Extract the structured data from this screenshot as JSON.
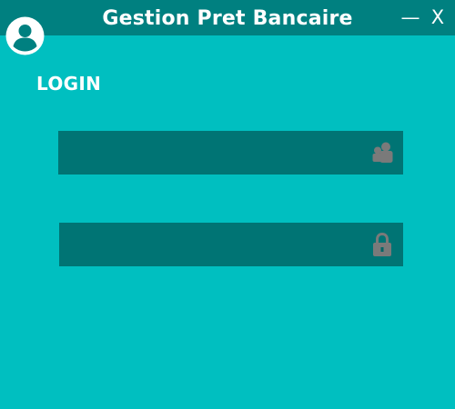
{
  "window": {
    "title": "Gestion Pret Bancaire",
    "minimize_label": "—",
    "close_label": "X"
  },
  "login": {
    "heading": "LOGIN",
    "username": {
      "value": "",
      "placeholder": "",
      "icon": "user-icon"
    },
    "password": {
      "value": "",
      "placeholder": "",
      "icon": "lock-icon"
    }
  },
  "colors": {
    "background": "#00BFC0",
    "titlebar": "#008080",
    "field": "#007474",
    "icon": "#7A7A7A",
    "text": "#FFFFFF"
  }
}
